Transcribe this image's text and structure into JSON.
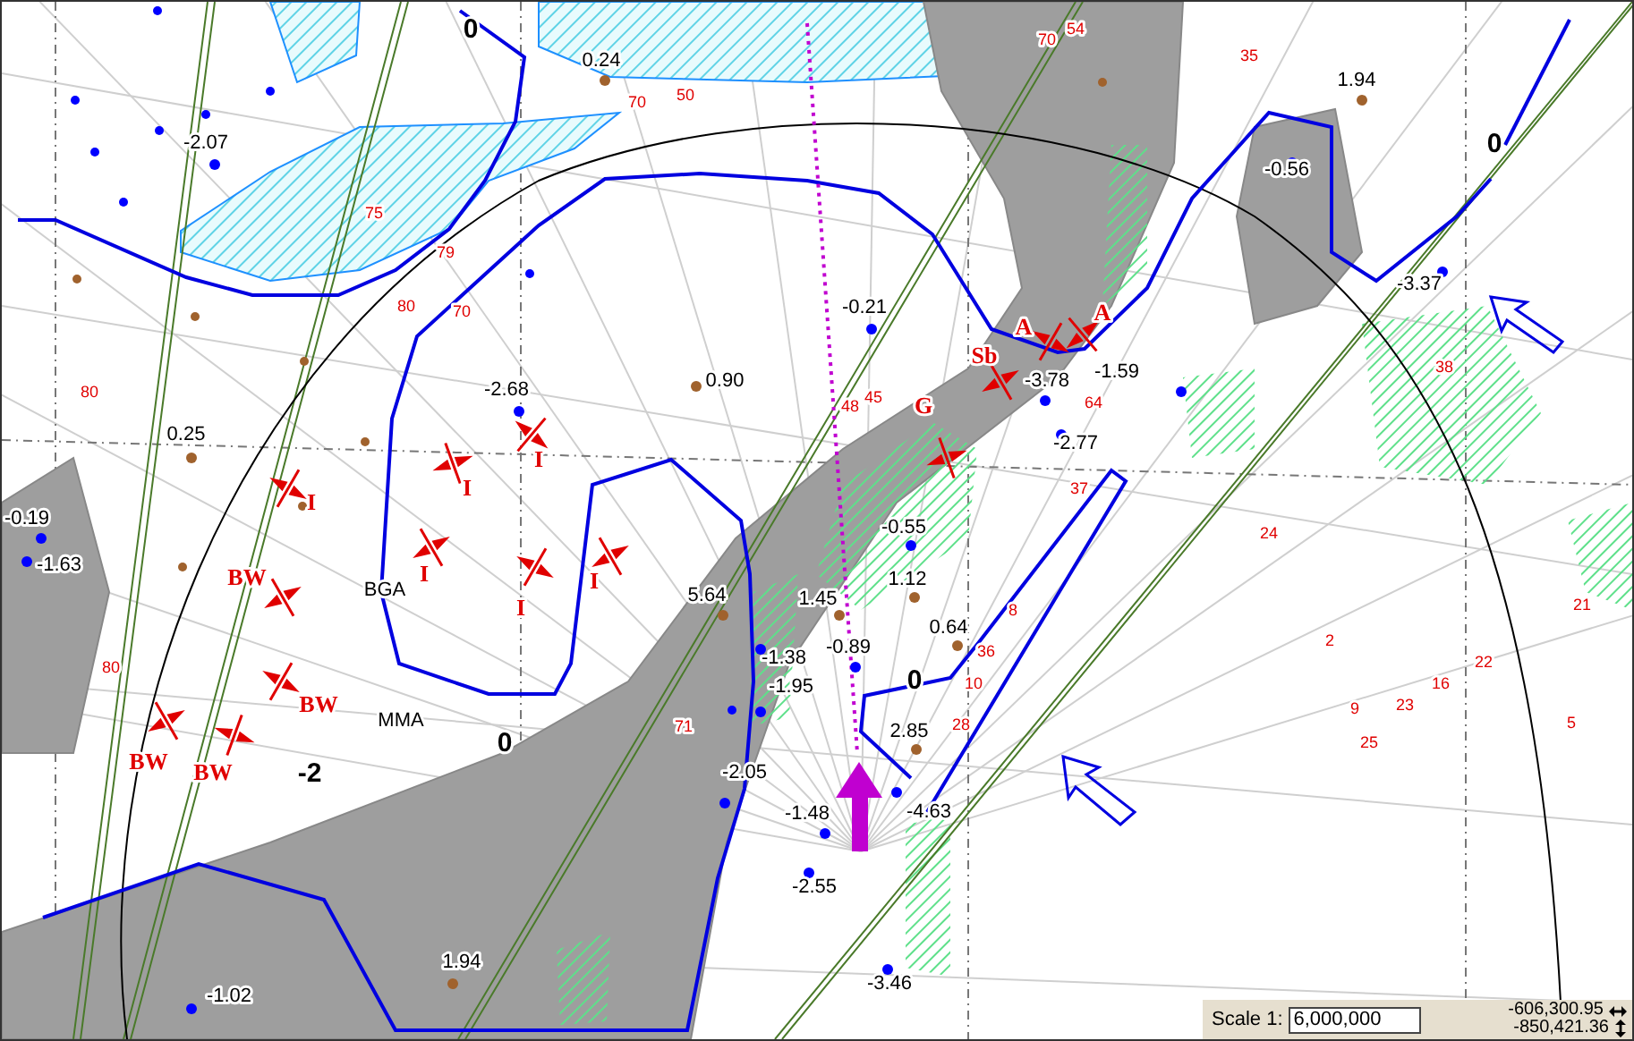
{
  "map": {
    "contour_labels": [
      "0",
      "0",
      "0",
      "0",
      "-2"
    ],
    "stations": [
      {
        "value": "0.24",
        "color": "#a0622d"
      },
      {
        "value": "-2.07",
        "color": "#0000ff"
      },
      {
        "value": "-0.56",
        "color": "#0000ff"
      },
      {
        "value": "1.94",
        "color": "#a0622d"
      },
      {
        "value": "-0.21",
        "color": "#0000ff"
      },
      {
        "value": "0.90",
        "color": "#a0622d"
      },
      {
        "value": "-2.68",
        "color": "#0000ff"
      },
      {
        "value": "-3.78",
        "color": "#0000ff"
      },
      {
        "value": "-1.59",
        "color": "#0000ff"
      },
      {
        "value": "-2.77",
        "color": "#0000ff"
      },
      {
        "value": "0.25",
        "color": "#a0622d"
      },
      {
        "value": "-0.19",
        "color": "#0000ff"
      },
      {
        "value": "-1.63",
        "color": "#0000ff"
      },
      {
        "value": "-3.37",
        "color": "#0000ff"
      },
      {
        "value": "-0.55",
        "color": "#0000ff"
      },
      {
        "value": "1.12",
        "color": "#a0622d"
      },
      {
        "value": "5.64",
        "color": "#a0622d"
      },
      {
        "value": "1.45",
        "color": "#a0622d"
      },
      {
        "value": "0.64",
        "color": "#a0622d"
      },
      {
        "value": "-1.38",
        "color": "#0000ff"
      },
      {
        "value": "-0.89",
        "color": "#0000ff"
      },
      {
        "value": "-1.95",
        "color": "#0000ff"
      },
      {
        "value": "2.85",
        "color": "#a0622d"
      },
      {
        "value": "-2.05",
        "color": "#0000ff"
      },
      {
        "value": "-1.48",
        "color": "#0000ff"
      },
      {
        "value": "-4.63",
        "color": "#0000ff"
      },
      {
        "value": "-2.55",
        "color": "#0000ff"
      },
      {
        "value": "1.94",
        "color": "#a0622d"
      },
      {
        "value": "-1.02",
        "color": "#0000ff"
      },
      {
        "value": "-3.46",
        "color": "#0000ff"
      }
    ],
    "weather_codes": [
      "A",
      "A",
      "Sb",
      "G",
      "I",
      "I",
      "I",
      "BW",
      "I",
      "I",
      "I",
      "BW",
      "BW",
      "BW"
    ],
    "report_numbers": [
      "70",
      "54",
      "35",
      "75",
      "79",
      "80",
      "70",
      "70",
      "50",
      "80",
      "48",
      "45",
      "64",
      "38",
      "37",
      "24",
      "2",
      "9",
      "23",
      "25",
      "16",
      "22",
      "21",
      "5",
      "8",
      "36",
      "10",
      "28",
      "80",
      "71"
    ],
    "station_ids": [
      "BGA",
      "MMA"
    ]
  },
  "scale_bar": {
    "label": "Scale 1:",
    "value": "6,000,000",
    "x_coordinate": "-606,300.95",
    "y_coordinate": "-850,421.36"
  }
}
